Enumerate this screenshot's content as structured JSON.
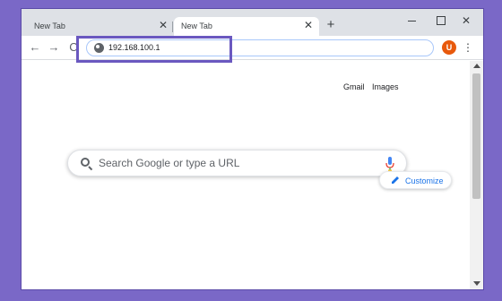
{
  "browser": {
    "tabs": [
      {
        "title": "New Tab",
        "active": false
      },
      {
        "title": "New Tab",
        "active": true
      }
    ],
    "new_tab_icon": "plus-icon",
    "window_controls": [
      "minimize-icon",
      "maximize-icon",
      "close-icon"
    ],
    "close_glyph": "✕",
    "plus_glyph": "+"
  },
  "toolbar": {
    "back_glyph": "←",
    "forward_glyph": "→",
    "reload_glyph": "C",
    "address": "192.168.100.1",
    "avatar_letter": "U",
    "menu_glyph": "⋮"
  },
  "page": {
    "links": {
      "gmail": "Gmail",
      "images": "Images"
    },
    "search_placeholder": "Search Google or type a URL",
    "customize_label": "Customize"
  },
  "colors": {
    "background": "#7a68c7",
    "highlight": "#6a58c0",
    "accent": "#1a73e8",
    "avatar": "#e8590c"
  }
}
